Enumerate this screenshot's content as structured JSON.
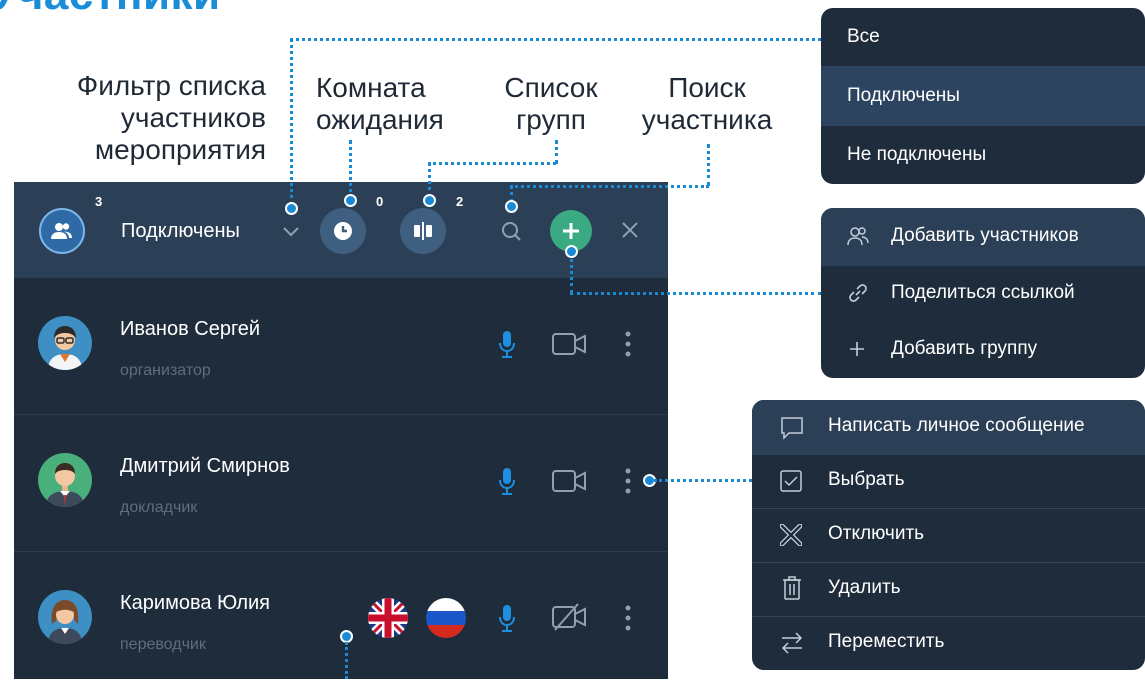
{
  "page": {
    "title": "Участники"
  },
  "annotations": {
    "filter": [
      "Фильтр списка",
      "участников",
      "мероприятия"
    ],
    "waiting": [
      "Комната",
      "ожидания"
    ],
    "groups": [
      "Список",
      "групп"
    ],
    "search": [
      "Поиск",
      "участника"
    ]
  },
  "toolbar": {
    "participants_count": "3",
    "filter_value": "Подключены",
    "waiting_count": "0",
    "groups_count": "2",
    "icons": [
      "participants-icon",
      "chevron-down-icon",
      "clock-icon",
      "groups-icon",
      "search-icon",
      "plus-icon",
      "close-icon"
    ]
  },
  "participants": [
    {
      "name": "Иванов Сергей",
      "role": "организатор",
      "mic": "on",
      "camera": "on"
    },
    {
      "name": "Дмитрий Смирнов",
      "role": "докладчик",
      "mic": "on",
      "camera": "on"
    },
    {
      "name": "Каримова Юлия",
      "role": "переводчик",
      "mic": "on",
      "camera": "off",
      "languages": [
        "en",
        "ru"
      ]
    }
  ],
  "filter_menu": {
    "items": [
      "Все",
      "Подключены",
      "Не подключены"
    ],
    "selected": "Подключены"
  },
  "add_menu": {
    "items": [
      "Добавить участников",
      "Поделиться ссылкой",
      "Добавить группу"
    ]
  },
  "participant_menu": {
    "items": [
      "Написать личное сообщение",
      "Выбрать",
      "Отключить",
      "Удалить",
      "Переместить"
    ]
  },
  "colors": {
    "accent": "#1a8cd8",
    "panel": "#1e2c3c",
    "toolbar": "#2b3f56",
    "add_button": "#3aaa82",
    "icon_button": "#3f5f80"
  }
}
